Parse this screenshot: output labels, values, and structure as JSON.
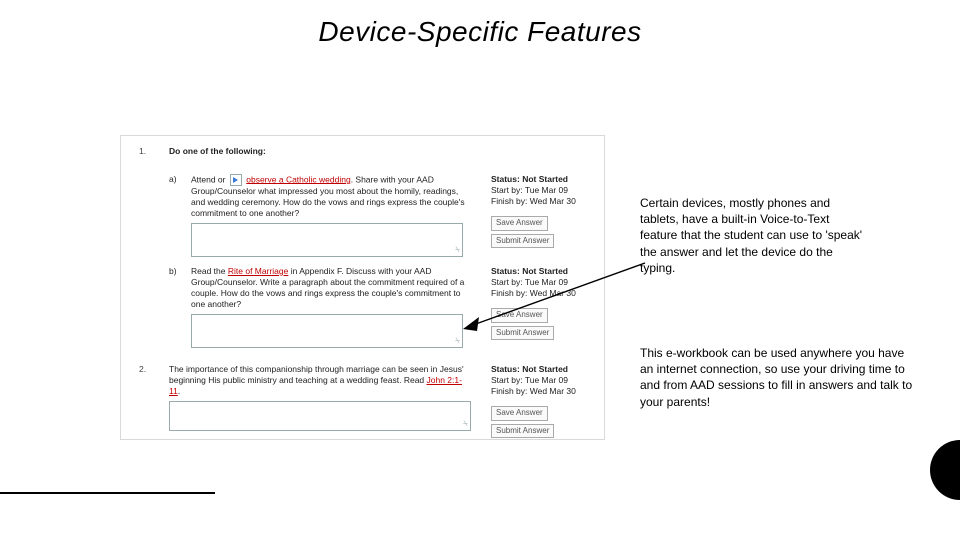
{
  "title": "Device-Specific Features",
  "paragraphs": {
    "p1": "Certain devices, mostly phones and tablets, have a built-in Voice-to-Text feature that the student can use to 'speak' the answer and let the device do the typing.",
    "p2": "This e-workbook can be used anywhere you have an internet connection, so use your driving time to and from AAD sessions to fill in answers and talk to your parents!"
  },
  "workbook": {
    "question1": {
      "number": "1.",
      "lead": "Do one of the following:",
      "a": {
        "letter": "a)",
        "pre": "Attend or",
        "link": "observe a Catholic wedding",
        "post": ". Share with your AAD Group/Counselor what impressed you most about the homily, readings, and wedding ceremony. How do the vows and rings express the couple's commitment to one another?"
      },
      "b": {
        "letter": "b)",
        "pre": "Read the",
        "link": "Rite of Marriage",
        "post": " in Appendix F. Discuss with your AAD Group/Counselor. Write a paragraph about the commitment required of a couple. How do the vows and rings express the couple's commitment to one another?"
      }
    },
    "question2": {
      "number": "2.",
      "text_pre": "The importance of this companionship through marriage can be seen in Jesus' beginning His public ministry and teaching at a wedding feast. Read ",
      "link": "John 2:1-11",
      "text_post": "."
    },
    "status": {
      "label": "Status:",
      "value": "Not Started",
      "start": "Start by: Tue Mar 09",
      "finish": "Finish by: Wed Mar 30"
    },
    "buttons": {
      "save": "Save Answer",
      "submit": "Submit Answer"
    }
  }
}
